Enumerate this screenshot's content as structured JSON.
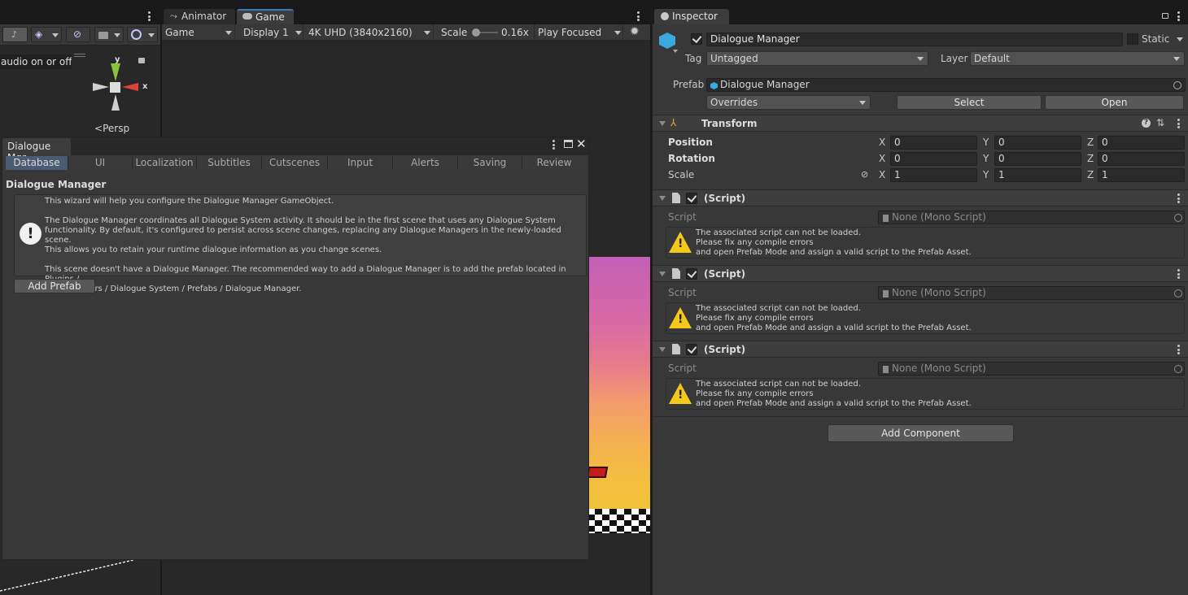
{
  "scene_panel": {
    "tooltip": "audio on or off.",
    "persp_label": "Persp",
    "axis_y": "y",
    "axis_x": "x"
  },
  "center_tabs": {
    "animator": "Animator",
    "game": "Game"
  },
  "game_toolbar": {
    "display_mode": "Game",
    "display": "Display 1",
    "resolution": "4K UHD (3840x2160)",
    "scale_label": "Scale",
    "scale_value": "0.16x",
    "play_mode": "Play Focused"
  },
  "wizard": {
    "title": "Dialogue Mgr",
    "tabs": [
      "Database",
      "UI",
      "Localization",
      "Subtitles",
      "Cutscenes",
      "Input",
      "Alerts",
      "Saving",
      "Review"
    ],
    "heading": "Dialogue Manager",
    "info_line1": "This wizard will help you configure the Dialogue Manager GameObject.",
    "info_para2_l1": "The Dialogue Manager coordinates all Dialogue System activity. It should be in the first scene that uses any Dialogue System",
    "info_para2_l2": "functionality. By default, it's configured to persist across scene changes, replacing any Dialogue Managers in the newly-loaded scene.",
    "info_para2_l3": "This allows you to retain your runtime dialogue information as you change scenes.",
    "info_para3_l1": "This scene doesn't have a Dialogue Manager. The recommended way to add a Dialogue Manager is to add the prefab located in Plugins /",
    "info_para3_l2": "Pixel Crushers / Dialogue System / Prefabs / Dialogue Manager.",
    "add_prefab": "Add Prefab"
  },
  "inspector": {
    "tab_title": "Inspector",
    "object_name": "Dialogue Manager",
    "static_label": "Static",
    "tag_label": "Tag",
    "tag_value": "Untagged",
    "layer_label": "Layer",
    "layer_value": "Default",
    "prefab_label": "Prefab",
    "prefab_value": "Dialogue Manager",
    "overrides": "Overrides",
    "select": "Select",
    "open": "Open",
    "transform": {
      "title": "Transform",
      "rows": [
        {
          "label": "Position",
          "x": "0",
          "y": "0",
          "z": "0"
        },
        {
          "label": "Rotation",
          "x": "0",
          "y": "0",
          "z": "0"
        },
        {
          "label": "Scale",
          "x": "1",
          "y": "1",
          "z": "1"
        }
      ],
      "axis_x": "X",
      "axis_y": "Y",
      "axis_z": "Z"
    },
    "scripts": [
      {
        "title": "(Script)",
        "field_label": "Script",
        "field_value": "None (Mono Script)",
        "warn1": "The associated script can not be loaded.",
        "warn2": "Please fix any compile errors",
        "warn3": "and open Prefab Mode and assign a valid script to the Prefab Asset."
      },
      {
        "title": "(Script)",
        "field_label": "Script",
        "field_value": "None (Mono Script)",
        "warn1": "The associated script can not be loaded.",
        "warn2": "Please fix any compile errors",
        "warn3": "and open Prefab Mode and assign a valid script to the Prefab Asset."
      },
      {
        "title": "(Script)",
        "field_label": "Script",
        "field_value": "None (Mono Script)",
        "warn1": "The associated script can not be loaded.",
        "warn2": "Please fix any compile errors",
        "warn3": "and open Prefab Mode and assign a valid script to the Prefab Asset."
      }
    ],
    "add_component": "Add Component"
  }
}
